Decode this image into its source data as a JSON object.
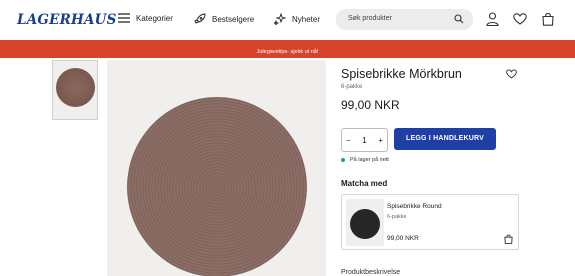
{
  "header": {
    "logo": "LAGERHAUS",
    "nav": [
      {
        "label": "Kategorier",
        "icon": "menu-icon"
      },
      {
        "label": "Bestselgere",
        "icon": "rocket-icon"
      },
      {
        "label": "Nyheter",
        "icon": "sparkle-icon"
      }
    ],
    "search_placeholder": "Søk produkter",
    "icons": [
      "account-icon",
      "wishlist-heart-icon",
      "shopping-bag-icon"
    ]
  },
  "banner": {
    "text": "Julegavetips- sjekk ut nå!",
    "color": "#d8432c"
  },
  "product": {
    "title": "Spisebrikke Mörkbrun",
    "subtitle": "6-pakke",
    "price": "99,00 NKR",
    "quantity": "1",
    "qty_minus": "−",
    "qty_plus": "+",
    "add_to_cart_label": "LEGG I HANDLEKURV",
    "stock_status": "På lager på nett",
    "accent_color": "#1f3fa5",
    "stock_color": "#2f9a84"
  },
  "match": {
    "heading": "Matcha med",
    "items": [
      {
        "name": "Spisebrikke Round",
        "subtitle": "6-pakke",
        "price": "99,00 NKR"
      }
    ]
  },
  "bottom_partial_text": "Produktbeskrivelse"
}
